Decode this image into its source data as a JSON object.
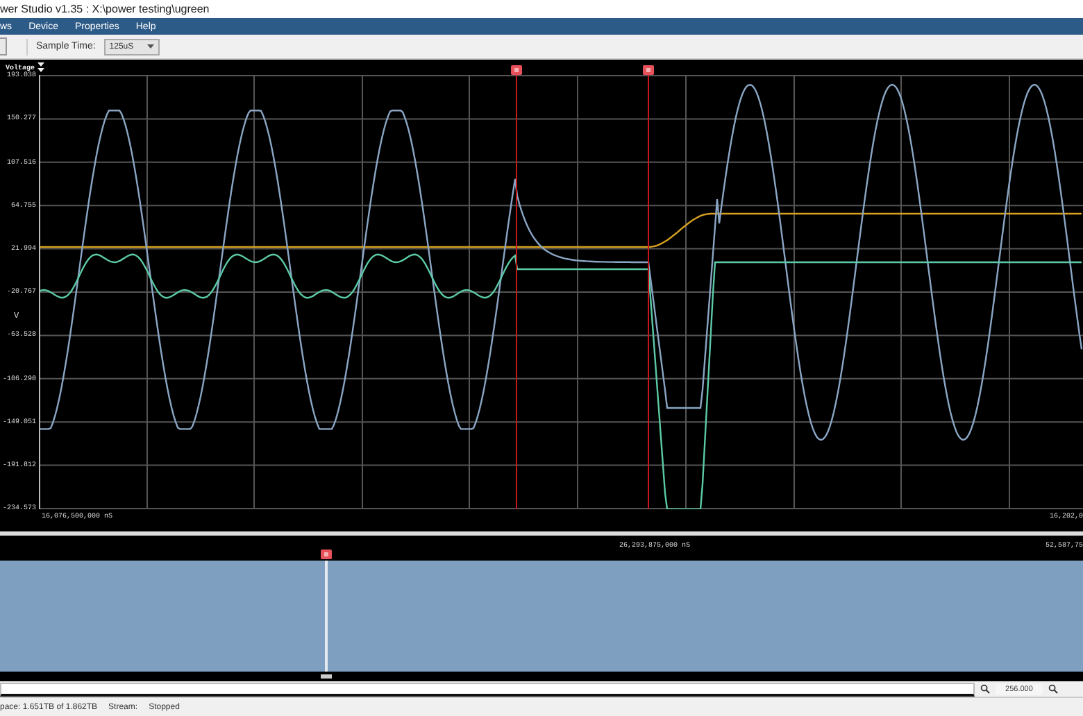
{
  "window": {
    "title": "wer Studio v1.35 : X:\\power testing\\ugreen"
  },
  "menu": [
    "ws",
    "Device",
    "Properties",
    "Help"
  ],
  "toolbar": {
    "sample_time_label": "Sample Time:",
    "sample_time_value": "125uS"
  },
  "chart": {
    "axis_title": "Voltage",
    "unit": "V",
    "y_ticks": [
      "193.038",
      "150.277",
      "107.516",
      "64.755",
      "21.994",
      "-20.767",
      "-63.528",
      "-106.290",
      "-149.051",
      "-191.812",
      "-234.573"
    ],
    "x_start": "16,076,500,000 nS",
    "x_end": "16,202,0"
  },
  "overview": {
    "center_label": "26,293,875,000 nS",
    "end_label": "52,587,75"
  },
  "zoom": {
    "value": "256.000"
  },
  "status_bar": {
    "space": "pace: 1.651TB of 1.862TB",
    "stream_label": "Stream:",
    "stream_value": "Stopped"
  }
}
